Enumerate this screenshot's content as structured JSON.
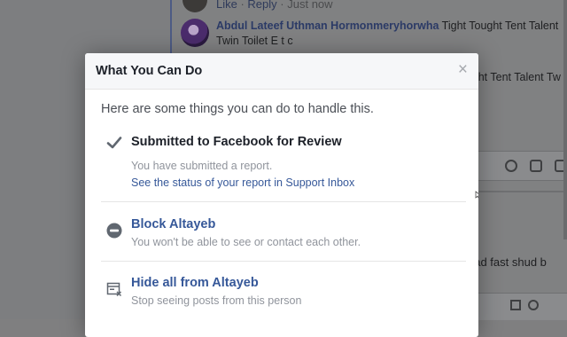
{
  "background": {
    "top_comment": {
      "like": "Like",
      "sep1": " · ",
      "reply": "Reply",
      "sep2": " · ",
      "time": "Just now"
    },
    "comment": {
      "author": "Abdul Lateef Uthman Hormonmeryhorwha",
      "text": " Tight Tought Tent Talent Twin Toilet E t c"
    },
    "line2": "ight Tent Talent Tw",
    "line3": "ead fast shud b",
    "bar_icons": [
      "emoji-icon",
      "camera-icon",
      "gif-icon"
    ],
    "box_icons": [
      "edit-icon",
      "gear-icon"
    ]
  },
  "dialog": {
    "title": "What You Can Do",
    "close_glyph": "×",
    "intro": "Here are some things you can do to handle this.",
    "options": [
      {
        "icon": "checkmark-icon",
        "title": "Submitted to Facebook for Review",
        "desc": "You have submitted a report.",
        "link": "See the status of your report in Support Inbox"
      },
      {
        "icon": "block-icon",
        "title": "Block Altayeb",
        "desc": "You won't be able to see or contact each other."
      },
      {
        "icon": "hide-icon",
        "title": "Hide all from Altayeb",
        "desc": "Stop seeing posts from this person"
      }
    ]
  },
  "colors": {
    "link": "#365899",
    "title": "#1d2129",
    "muted": "#90949c",
    "header_bg": "#f6f7f9"
  }
}
